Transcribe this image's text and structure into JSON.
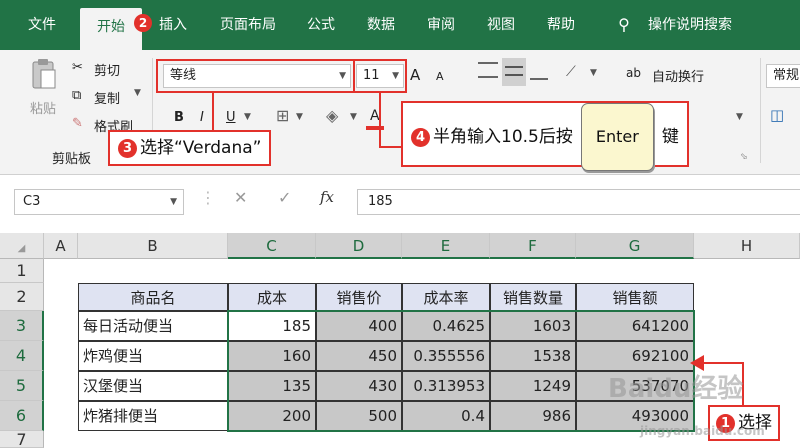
{
  "tabs": [
    "文件",
    "开始",
    "插入",
    "页面布局",
    "公式",
    "数据",
    "审阅",
    "视图",
    "帮助",
    "操作说明搜索"
  ],
  "badges": {
    "tab": "2",
    "select": "1"
  },
  "clipboard": {
    "paste": "粘贴",
    "cut": "剪切",
    "copy": "复制",
    "painter": "格式刷",
    "group": "剪贴板"
  },
  "font": {
    "name": "等线",
    "size": "11",
    "grow": "A",
    "shrink": "A",
    "bold": "B",
    "italic": "I",
    "underline": "U",
    "color_letter": "A"
  },
  "alignment": {
    "wrap": "自动换行",
    "wrap_glyph": "ab"
  },
  "number_group": "常规",
  "callouts": {
    "step3_num": "3",
    "step3_text": "选择“Verdana”",
    "step4_num": "4",
    "step4_text": "半角输入10.5后按",
    "step4_key": "Enter",
    "step4_suffix": "键",
    "step1_text": "选择"
  },
  "formula_bar": {
    "name_box": "C3",
    "fx": "fx",
    "value": "185"
  },
  "sheet": {
    "columns": [
      "A",
      "B",
      "C",
      "D",
      "E",
      "F",
      "G",
      "H"
    ],
    "rows": [
      "1",
      "2",
      "3",
      "4",
      "5",
      "6",
      "7"
    ],
    "headers": [
      "商品名",
      "成本",
      "销售价",
      "成本率",
      "销售数量",
      "销售额"
    ],
    "data": [
      [
        "每日活动便当",
        "185",
        "400",
        "0.4625",
        "1603",
        "641200"
      ],
      [
        "炸鸡便当",
        "160",
        "450",
        "0.355556",
        "1538",
        "692100"
      ],
      [
        "汉堡便当",
        "135",
        "430",
        "0.313953",
        "1249",
        "537070"
      ],
      [
        "炸猪排便当",
        "200",
        "500",
        "0.4",
        "986",
        "493000"
      ]
    ]
  },
  "watermark": {
    "logo": "Baidu经验",
    "url": "jingyan.baidu.com"
  },
  "colors": {
    "excel_green": "#217346",
    "callout_red": "#e2312b",
    "header_fill": "#dfe3f2",
    "selection_fill": "#c8c8c8"
  }
}
